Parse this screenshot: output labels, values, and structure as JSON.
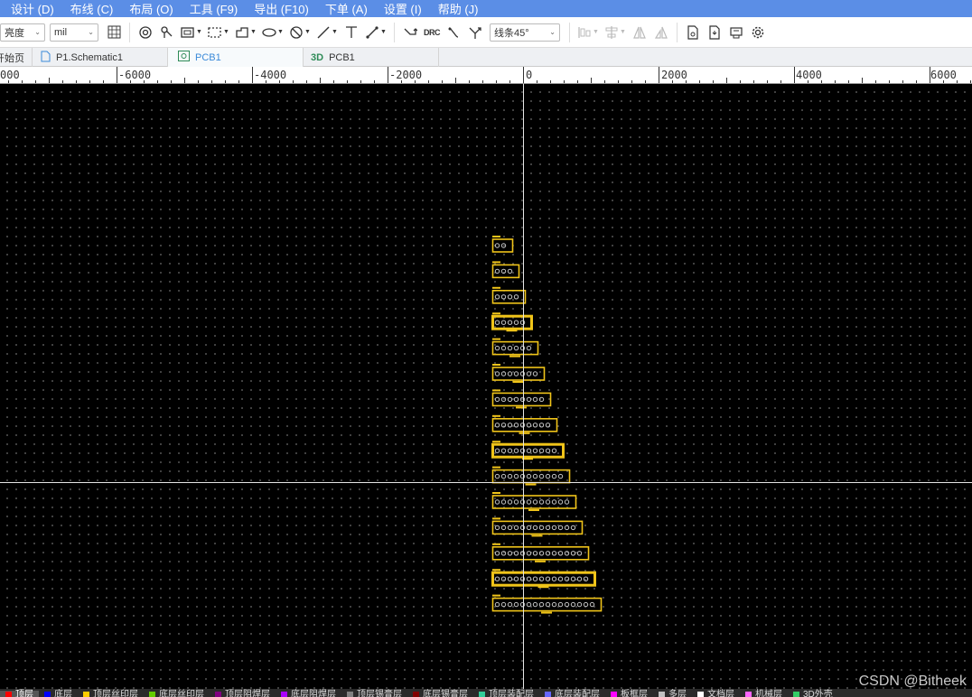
{
  "menu": [
    "设计 (D)",
    "布线 (C)",
    "布局 (O)",
    "工具 (F9)",
    "导出 (F10)",
    "下单 (A)",
    "设置 (I)",
    "帮助 (J)"
  ],
  "toolbar": {
    "linewidth_select": "亮度",
    "unit_select": "mil",
    "drc_label": "DRC",
    "routing_mode": "线条45°"
  },
  "tabs": [
    {
      "label": "开始页",
      "icon": "home-icon",
      "active": false
    },
    {
      "label": "P1.Schematic1",
      "icon": "schematic-file-icon",
      "active": false
    },
    {
      "label": "PCB1",
      "icon": "pcb-file-icon",
      "active": true
    },
    {
      "label": "PCB1",
      "icon": "3d-icon",
      "active": false
    }
  ],
  "tab_3d_prefix": "3D",
  "ruler": {
    "labels": [
      "000",
      "-6000",
      "-4000",
      "-2000",
      "0",
      "2000",
      "4000",
      "6000"
    ]
  },
  "components": [
    {
      "pins": 2
    },
    {
      "pins": 3
    },
    {
      "pins": 4
    },
    {
      "pins": 5
    },
    {
      "pins": 6
    },
    {
      "pins": 7
    },
    {
      "pins": 8
    },
    {
      "pins": 9
    },
    {
      "pins": 10
    },
    {
      "pins": 11
    },
    {
      "pins": 12
    },
    {
      "pins": 13
    },
    {
      "pins": 14
    },
    {
      "pins": 15
    },
    {
      "pins": 16
    }
  ],
  "layers": [
    {
      "label": "顶层",
      "color": "#ff0000",
      "active": true
    },
    {
      "label": "底层",
      "color": "#0000ff",
      "active": false
    },
    {
      "label": "顶层丝印层",
      "color": "#ffcc00",
      "active": false
    },
    {
      "label": "底层丝印层",
      "color": "#66cc00",
      "active": false
    },
    {
      "label": "顶层阻焊层",
      "color": "#800080",
      "active": false
    },
    {
      "label": "底层阻焊层",
      "color": "#aa00ff",
      "active": false
    },
    {
      "label": "顶层锡膏层",
      "color": "#808080",
      "active": false
    },
    {
      "label": "底层锡膏层",
      "color": "#800000",
      "active": false
    },
    {
      "label": "顶层装配层",
      "color": "#33cc99",
      "active": false
    },
    {
      "label": "底层装配层",
      "color": "#6666ff",
      "active": false
    },
    {
      "label": "板框层",
      "color": "#ff00ff",
      "active": false
    },
    {
      "label": "多层",
      "color": "#c0c0c0",
      "active": false
    },
    {
      "label": "文档层",
      "color": "#ffffff",
      "active": false
    },
    {
      "label": "机械层",
      "color": "#ff66ff",
      "active": false
    },
    {
      "label": "3D外壳",
      "color": "#33cc66",
      "active": false
    }
  ],
  "watermark": "CSDN @Bitheek",
  "colors": {
    "menubar": "#5b8ee6",
    "canvas": "#000000",
    "silkscreen": "#f0c419",
    "pad": "#c8c8c8",
    "crosshair": "#e6e6e6"
  }
}
